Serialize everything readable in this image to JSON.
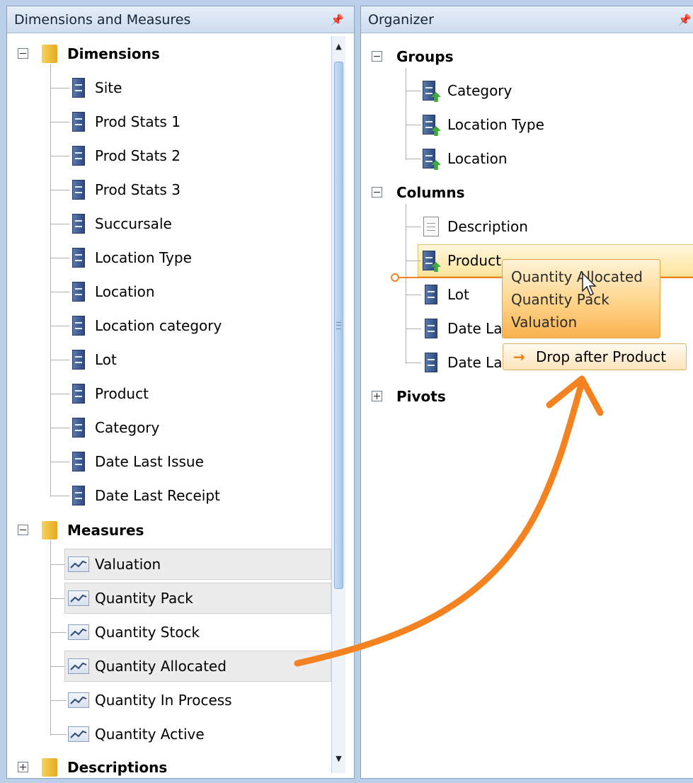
{
  "left_panel": {
    "title": "Dimensions and Measures",
    "dimensions_label": "Dimensions",
    "dimensions": [
      "Site",
      "Prod Stats 1",
      "Prod Stats 2",
      "Prod Stats 3",
      "Succursale",
      "Location Type",
      "Location",
      "Location category",
      "Lot",
      "Product",
      "Category",
      "Date Last Issue",
      "Date Last Receipt"
    ],
    "measures_label": "Measures",
    "measures": [
      "Valuation",
      "Quantity Pack",
      "Quantity Stock",
      "Quantity Allocated",
      "Quantity In Process",
      "Quantity Active"
    ],
    "descriptions_label": "Descriptions"
  },
  "right_panel": {
    "title": "Organizer",
    "groups_label": "Groups",
    "groups": [
      "Category",
      "Location Type",
      "Location"
    ],
    "columns_label": "Columns",
    "columns": [
      "Description",
      "Product",
      "Lot",
      "Date Last Issue",
      "Date La"
    ],
    "pivots_label": "Pivots"
  },
  "drag_popup": {
    "items": [
      "Quantity Allocated",
      "Quantity Pack",
      "Valuation"
    ]
  },
  "drop_hint": {
    "label": "Drop after Product"
  },
  "colors": {
    "accent_orange": "#f58220",
    "header_bg": "#d7e3f1",
    "dimension_icon": "#2d4a80"
  },
  "icons": {
    "folder": "folder-icon",
    "dimension": "dimension-icon",
    "measure": "measure-icon",
    "group_dimension": "dimension-group-icon",
    "description": "document-icon"
  }
}
